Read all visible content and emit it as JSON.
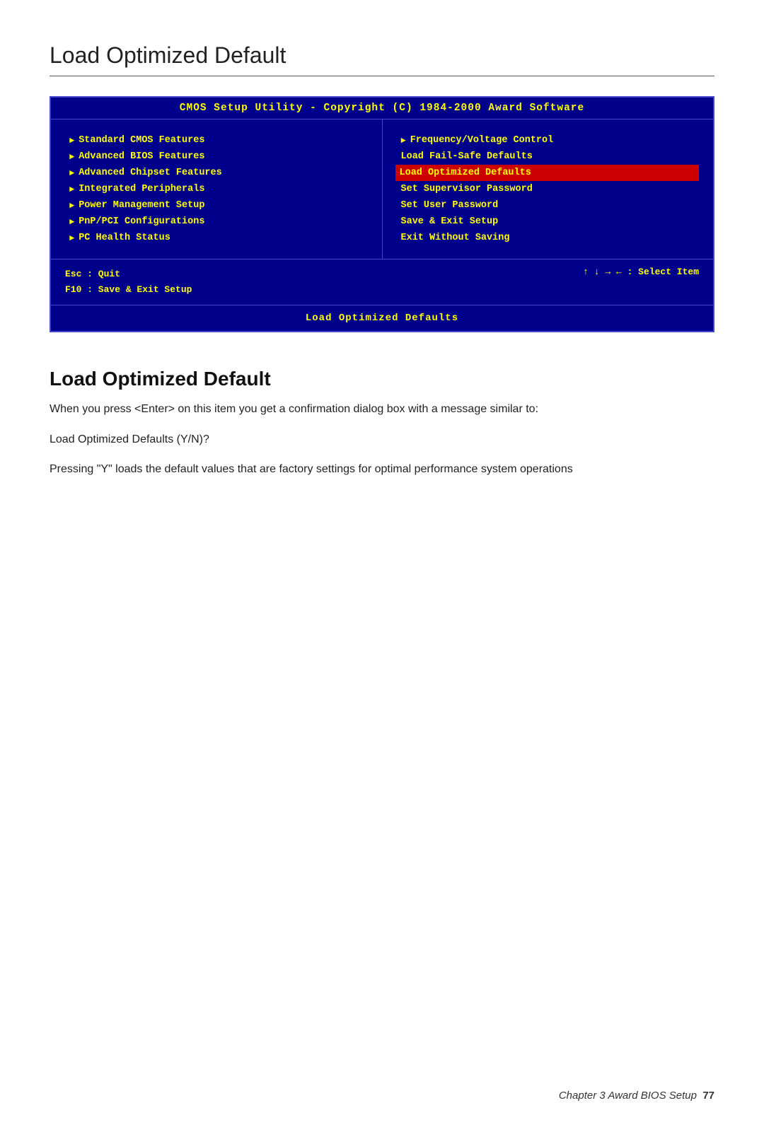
{
  "top_heading": "Load Optimized Default",
  "bios": {
    "title_bar": "CMOS Setup Utility - Copyright (C) 1984-2000 Award Software",
    "left_menu": [
      {
        "label": "Standard CMOS Features",
        "has_arrow": true
      },
      {
        "label": "Advanced BIOS Features",
        "has_arrow": true
      },
      {
        "label": "Advanced Chipset Features",
        "has_arrow": true
      },
      {
        "label": "Integrated Peripherals",
        "has_arrow": true
      },
      {
        "label": "Power Management Setup",
        "has_arrow": true
      },
      {
        "label": "PnP/PCI Configurations",
        "has_arrow": true
      },
      {
        "label": "PC Health Status",
        "has_arrow": true
      }
    ],
    "right_menu": [
      {
        "label": "Frequency/Voltage Control",
        "has_arrow": true,
        "highlighted": false
      },
      {
        "label": "Load Fail-Safe Defaults",
        "has_arrow": false,
        "highlighted": false
      },
      {
        "label": "Load Optimized Defaults",
        "has_arrow": false,
        "highlighted": true
      },
      {
        "label": "Set Supervisor Password",
        "has_arrow": false,
        "highlighted": false
      },
      {
        "label": "Set User Password",
        "has_arrow": false,
        "highlighted": false
      },
      {
        "label": "Save & Exit Setup",
        "has_arrow": false,
        "highlighted": false
      },
      {
        "label": "Exit Without Saving",
        "has_arrow": false,
        "highlighted": false
      }
    ],
    "footer_left_line1": "Esc : Quit",
    "footer_left_line2": "F10 : Save & Exit Setup",
    "footer_right": "↑ ↓ → ←   : Select Item",
    "status_bar": "Load Optimized Defaults"
  },
  "content": {
    "title": "Load Optimized Default",
    "paragraph1": "When you press <Enter> on this item you get a confirmation dialog box with a message similar to:",
    "query": "Load Optimized Defaults (Y/N)?",
    "paragraph2": "Pressing \"Y\" loads the default values that are factory settings for optimal performance system operations"
  },
  "page_footer": {
    "chapter": "Chapter 3  Award BIOS Setup",
    "page_number": "77"
  }
}
